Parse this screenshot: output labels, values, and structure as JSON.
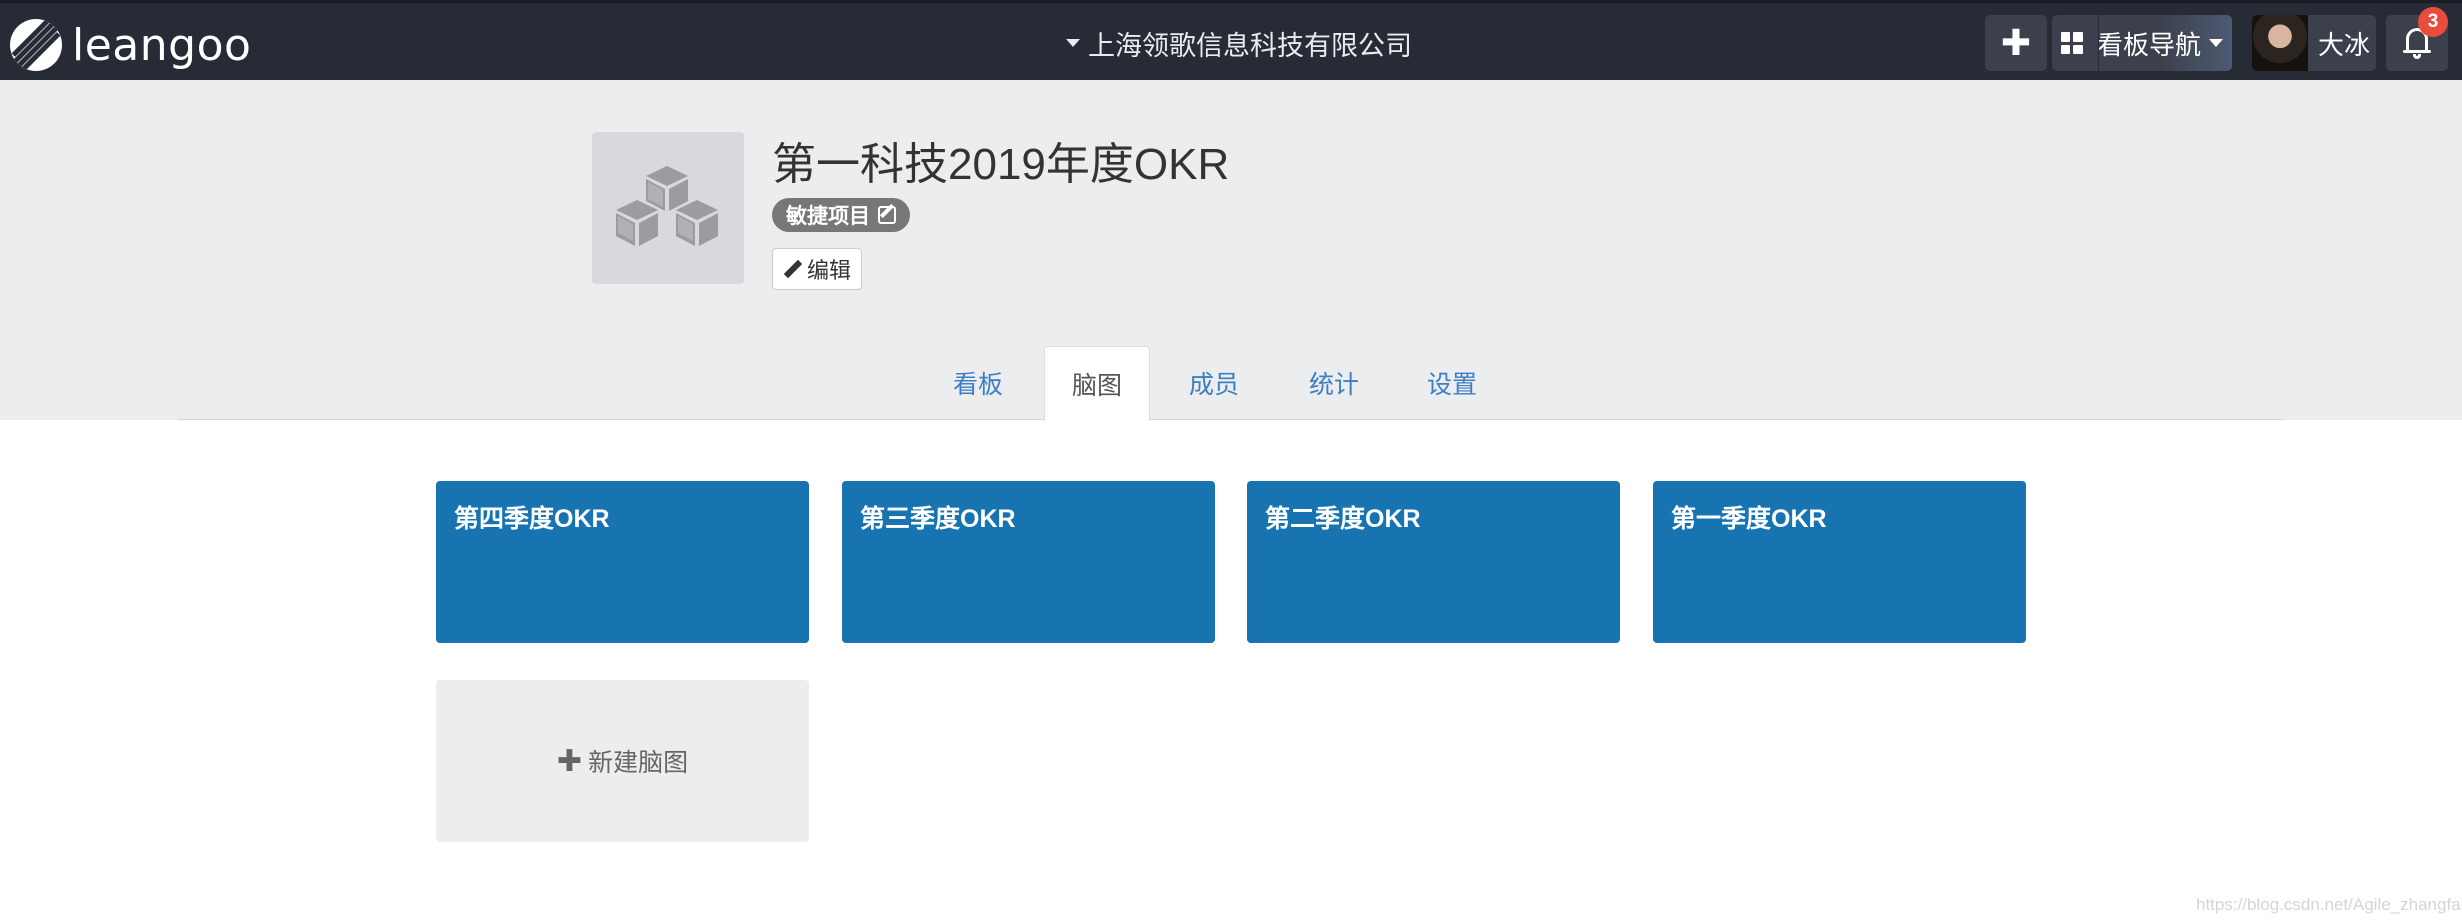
{
  "app": {
    "brand": "leangoo"
  },
  "topbar": {
    "org_name": "上海领歌信息科技有限公司",
    "add_symbol": "✚",
    "board_nav_label": "看板导航",
    "user_name": "大冰",
    "notification_count": "3"
  },
  "project": {
    "title": "第一科技2019年度OKR",
    "type_tag": "敏捷项目",
    "edit_label": "编辑"
  },
  "tabs": [
    {
      "label": "看板",
      "active": false
    },
    {
      "label": "脑图",
      "active": true
    },
    {
      "label": "成员",
      "active": false
    },
    {
      "label": "统计",
      "active": false
    },
    {
      "label": "设置",
      "active": false
    }
  ],
  "mindmaps": [
    {
      "title": "第四季度OKR"
    },
    {
      "title": "第三季度OKR"
    },
    {
      "title": "第二季度OKR"
    },
    {
      "title": "第一季度OKR"
    }
  ],
  "new_mindmap": {
    "icon": "✚",
    "label": "新建脑图"
  },
  "watermark": "https://blog.csdn.net/Agile_zhangfan",
  "colors": {
    "topbar_bg": "#272b36",
    "card_blue": "#1874b0",
    "tab_link": "#3d7ec4",
    "badge_red": "#e74c3c",
    "band_gray": "#ecedef"
  },
  "icons": [
    "logo-icon",
    "caret-down-icon",
    "plus-icon",
    "grid-icon",
    "avatar",
    "bell-icon",
    "cubes-icon",
    "edit-icon",
    "pencil-icon"
  ]
}
